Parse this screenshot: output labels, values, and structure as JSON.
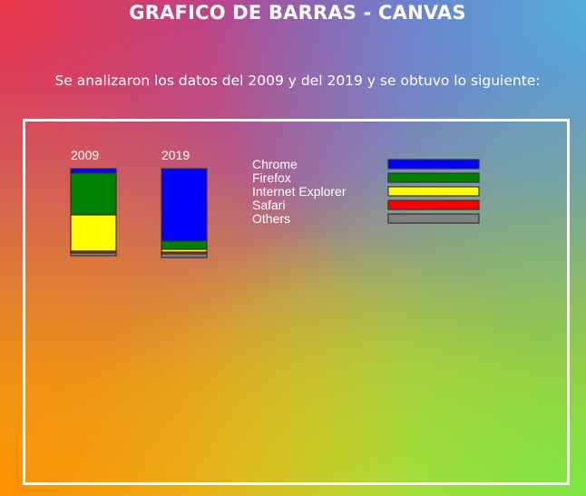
{
  "header": {
    "title": "GRAFICO DE BARRAS - CANVAS",
    "subtitle": "Se analizaron los datos del 2009 y del 2019 y se obtuvo lo siguiente:"
  },
  "chart_data": {
    "type": "bar",
    "stacked": true,
    "categories": [
      "2009",
      "2019"
    ],
    "series": [
      {
        "name": "Chrome",
        "color": "#0000ff",
        "values": [
          5,
          80
        ]
      },
      {
        "name": "Firefox",
        "color": "#008000",
        "values": [
          46,
          9
        ]
      },
      {
        "name": "Internet Explorer",
        "color": "#ffff00",
        "values": [
          40,
          3
        ]
      },
      {
        "name": "Safari",
        "color": "#ff0000",
        "values": [
          2,
          2
        ]
      },
      {
        "name": "Others",
        "color": "#808080",
        "values": [
          3,
          4
        ]
      }
    ],
    "legend_position": "right",
    "grid": false
  }
}
